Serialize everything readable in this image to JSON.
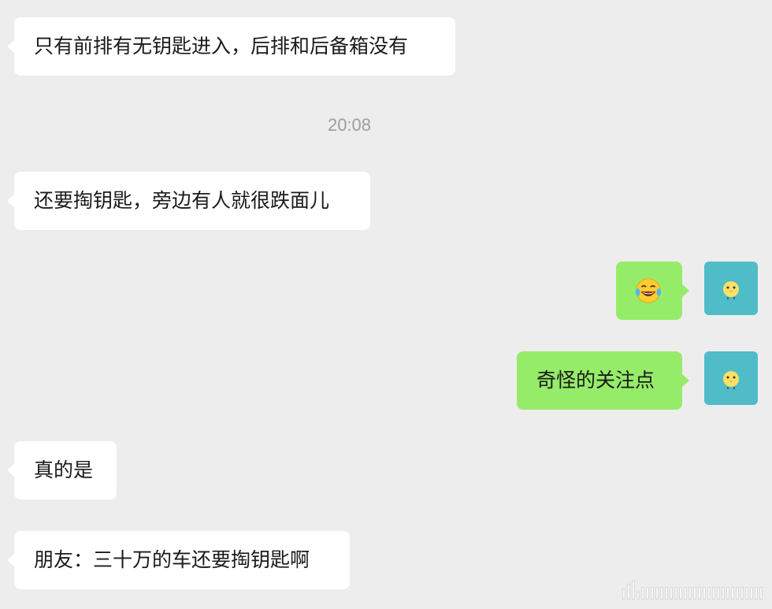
{
  "messages": {
    "m1": {
      "sender": "other",
      "text": "只有前排有无钥匙进入，后排和后备箱没有"
    },
    "timestamp": "20:08",
    "m2": {
      "sender": "other",
      "text": "还要掏钥匙，旁边有人就很跌面儿"
    },
    "m3": {
      "sender": "self",
      "type": "emoji",
      "emoji": "laughing-with-tears-emoji"
    },
    "m4": {
      "sender": "self",
      "text": "奇怪的关注点"
    },
    "m5": {
      "sender": "other",
      "text": "真的是"
    },
    "m6": {
      "sender": "other",
      "text": "朋友：三十万的车还要掏钥匙啊"
    }
  },
  "colors": {
    "background": "#ededed",
    "incoming_bubble": "#ffffff",
    "outgoing_bubble": "#95ec69",
    "avatar_bg": "#4fbcc8",
    "timestamp_text": "#9d9d9d"
  },
  "icons": {
    "avatar": "chick-avatar-icon",
    "watermark": "weibo-watermark-icon"
  }
}
